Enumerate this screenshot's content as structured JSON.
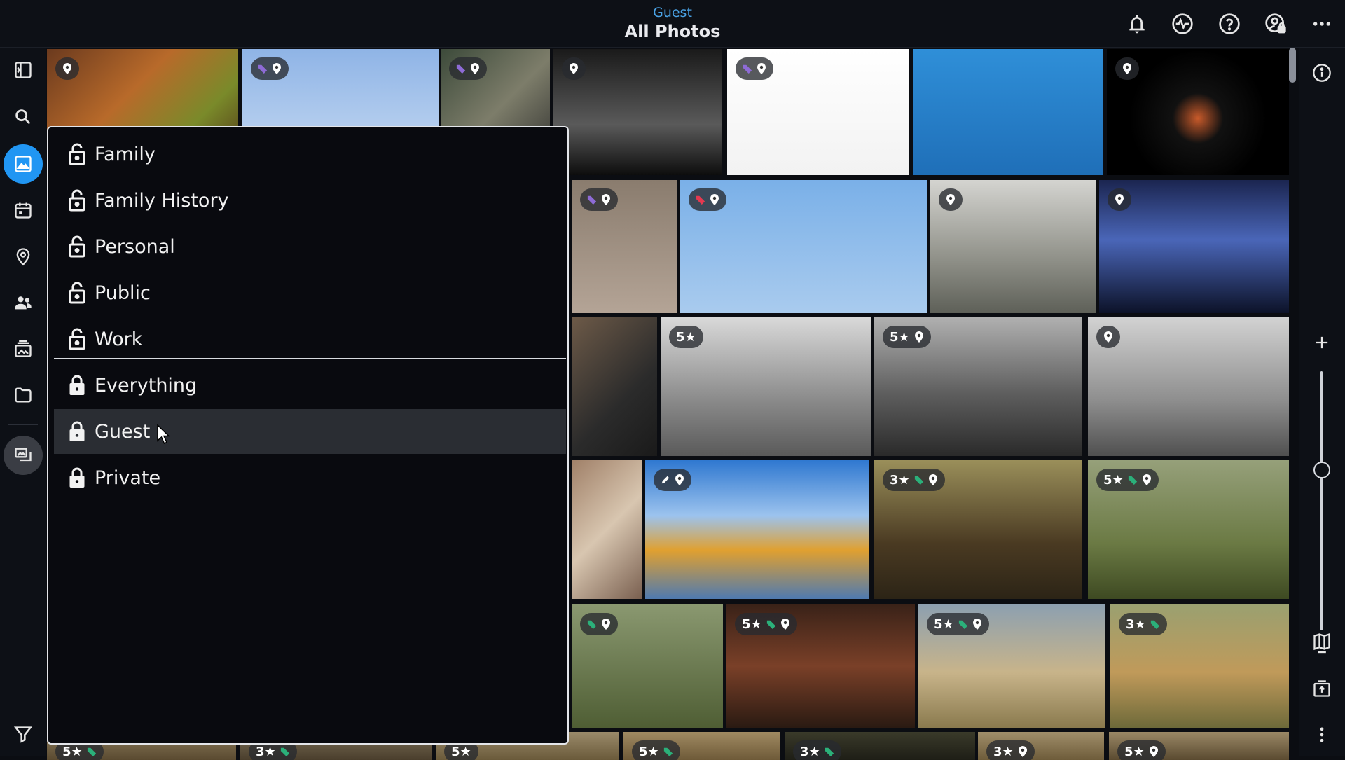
{
  "header": {
    "subtitle": "Guest",
    "title": "All Photos"
  },
  "header_icons": [
    "bell-icon",
    "activity-icon",
    "help-icon",
    "account-lock-icon",
    "more-horizontal-icon"
  ],
  "left_rail": [
    "sidebar-toggle-icon",
    "search-icon",
    "photos-icon",
    "calendar-icon",
    "places-icon",
    "people-icon",
    "albums-icon",
    "folders-icon",
    "library-icon",
    "filter-icon"
  ],
  "right_rail": [
    "info-icon",
    "zoom-in-icon",
    "zoom-out-icon",
    "map-book-icon",
    "upload-icon",
    "more-vertical-icon"
  ],
  "zoom_level_fraction": 0.38,
  "colors": {
    "accent": "#2196f3",
    "subtitle": "#4aa3e6",
    "tag_purple": "#8e6bd6",
    "tag_red": "#e53950",
    "tag_green": "#2bb07a"
  },
  "dropdown": {
    "groups": [
      {
        "items": [
          {
            "label": "Family",
            "locked": false
          },
          {
            "label": "Family History",
            "locked": false
          },
          {
            "label": "Personal",
            "locked": false
          },
          {
            "label": "Public",
            "locked": false
          },
          {
            "label": "Work",
            "locked": false
          }
        ]
      },
      {
        "items": [
          {
            "label": "Everything",
            "locked": true
          },
          {
            "label": "Guest",
            "locked": true,
            "hovered": true
          },
          {
            "label": "Private",
            "locked": true
          }
        ]
      }
    ]
  },
  "photo_badges": [
    {
      "stars": "",
      "tag": "",
      "pin": true
    },
    {
      "stars": "",
      "tag": "purple",
      "pin": true
    },
    {
      "stars": "",
      "tag": "purple",
      "pin": true
    },
    {
      "stars": "",
      "tag": "",
      "pin": true
    },
    {
      "stars": "",
      "tag": "purple",
      "pin": true
    },
    {
      "stars": "",
      "tag": "",
      "pin": false
    },
    {
      "stars": "",
      "tag": "",
      "pin": true
    },
    {
      "stars": "",
      "tag": "purple",
      "pin": true
    },
    {
      "stars": "",
      "tag": "red",
      "pin": true
    },
    {
      "stars": "",
      "tag": "",
      "pin": true
    },
    {
      "stars": "",
      "tag": "",
      "pin": true
    },
    {
      "stars": "",
      "tag": "",
      "pin": false
    },
    {
      "stars": "5★",
      "tag": "",
      "pin": false
    },
    {
      "stars": "5★",
      "tag": "",
      "pin": true
    },
    {
      "stars": "",
      "tag": "",
      "pin": true
    },
    {
      "stars": "",
      "tag": "",
      "pin": false
    },
    {
      "stars": "",
      "tag": "",
      "pin": true,
      "edit": true
    },
    {
      "stars": "3★",
      "tag": "green",
      "pin": true
    },
    {
      "stars": "5★",
      "tag": "green",
      "pin": true
    },
    {
      "stars": "",
      "tag": "green",
      "pin": true
    },
    {
      "stars": "5★",
      "tag": "green",
      "pin": true
    },
    {
      "stars": "5★",
      "tag": "green",
      "pin": true
    },
    {
      "stars": "3★",
      "tag": "green",
      "pin": false
    },
    {
      "stars": "5★",
      "tag": "green",
      "pin": false
    },
    {
      "stars": "3★",
      "tag": "green",
      "pin": false
    },
    {
      "stars": "5★",
      "tag": "",
      "pin": false
    },
    {
      "stars": "5★",
      "tag": "green",
      "pin": false
    },
    {
      "stars": "3★",
      "tag": "green",
      "pin": false
    },
    {
      "stars": "3★",
      "tag": "",
      "pin": true
    },
    {
      "stars": "5★",
      "tag": "",
      "pin": true
    }
  ]
}
